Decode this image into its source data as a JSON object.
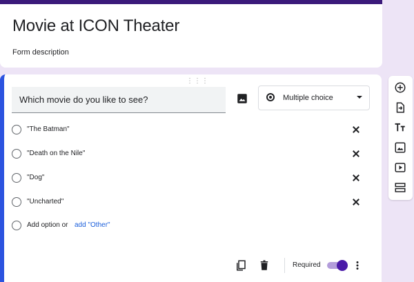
{
  "form": {
    "title": "Movie at ICON Theater",
    "description": "Form description"
  },
  "question": {
    "text": "Which movie do you like to see?",
    "type_label": "Multiple choice",
    "options": [
      "\"The Batman\"",
      "\"Death on the Nile\"",
      "\"Dog\"",
      "\"Uncharted\""
    ],
    "add_option_label": "Add option",
    "or_label": "or",
    "add_other_label": "add \"Other\"",
    "required_label": "Required",
    "required": true
  },
  "icons": {
    "drag": "drag-handle-icon",
    "image": "image-icon",
    "radio": "radio-button-icon",
    "chevron": "chevron-down-icon",
    "remove": "close-icon",
    "duplicate": "copy-icon",
    "delete": "trash-icon",
    "more": "more-vert-icon",
    "toolbar": [
      "add-question-icon",
      "import-questions-icon",
      "add-title-icon",
      "add-image-icon",
      "add-video-icon",
      "add-section-icon"
    ]
  },
  "colors": {
    "header_accent": "#3b1a7a",
    "active_border": "#2b53e0",
    "toggle_on": "#4a1aa8",
    "link": "#1a5edb",
    "background": "#ede4f6"
  }
}
